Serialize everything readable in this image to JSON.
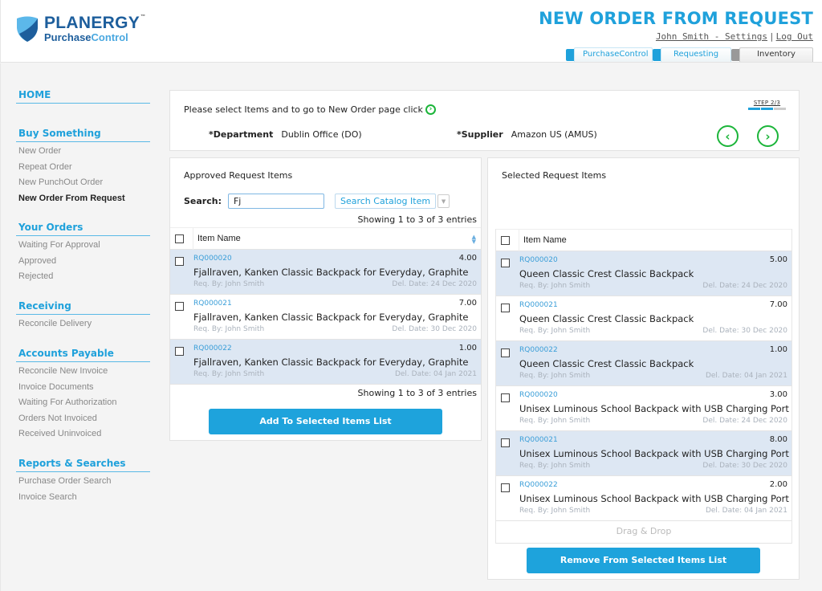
{
  "header": {
    "logo_main": "PLANERGY",
    "logo_tm": "™",
    "logo_sub_a": "Purchase",
    "logo_sub_b": "Control",
    "page_title": "NEW ORDER FROM REQUEST",
    "user_link": "John Smith - Settings",
    "separator": "|",
    "logout_link": "Log Out",
    "app_tabs": [
      {
        "label": "PurchaseControl",
        "color": "#1fa1db"
      },
      {
        "label": "Requesting",
        "color": "#1fa1db"
      },
      {
        "label": "Inventory",
        "color": "#999999"
      }
    ]
  },
  "sidebar": {
    "home": "HOME",
    "groups": [
      {
        "title": "Buy Something",
        "items": [
          "New Order",
          "Repeat Order",
          "New PunchOut Order",
          "New Order From Request"
        ],
        "active": "New Order From Request"
      },
      {
        "title": "Your Orders",
        "items": [
          "Waiting For Approval",
          "Approved",
          "Rejected"
        ]
      },
      {
        "title": "Receiving",
        "items": [
          "Reconcile Delivery"
        ]
      },
      {
        "title": "Accounts Payable",
        "items": [
          "Reconcile New Invoice",
          "Invoice Documents",
          "Waiting For Authorization",
          "Orders Not Invoiced",
          "Received Uninvoiced"
        ]
      },
      {
        "title": "Reports & Searches",
        "items": [
          "Purchase Order Search",
          "Invoice Search"
        ]
      }
    ]
  },
  "order_info": {
    "instruction": "Please select Items and to go to New Order page click",
    "department_label": "*Department",
    "department_value": "Dublin Office (DO)",
    "supplier_label": "*Supplier",
    "supplier_value": "Amazon US (AMUS)",
    "step_label": "STEP 2/3",
    "step_current": 2,
    "step_total": 3
  },
  "approved": {
    "title": "Approved Request Items",
    "search_label": "Search:",
    "search_value": "Fj",
    "catalog_button": "Search Catalog Item",
    "showing_top": "Showing 1 to 3 of 3 entries",
    "showing_bottom": "Showing 1 to 3 of 3 entries",
    "column_header": "Item Name",
    "rows": [
      {
        "rq": "RQ000020",
        "qty": "4.00",
        "name": "Fjallraven, Kanken Classic Backpack for Everyday, Graphite",
        "req_by": "Req. By: John Smith",
        "del_date": "Del. Date: 24 Dec 2020"
      },
      {
        "rq": "RQ000021",
        "qty": "7.00",
        "name": "Fjallraven, Kanken Classic Backpack for Everyday, Graphite",
        "req_by": "Req. By: John Smith",
        "del_date": "Del. Date: 30 Dec 2020"
      },
      {
        "rq": "RQ000022",
        "qty": "1.00",
        "name": "Fjallraven, Kanken Classic Backpack for Everyday, Graphite",
        "req_by": "Req. By: John Smith",
        "del_date": "Del. Date: 04 Jan 2021"
      }
    ],
    "add_button": "Add To Selected Items List"
  },
  "selected": {
    "title": "Selected Request Items",
    "column_header": "Item Name",
    "rows": [
      {
        "rq": "RQ000020",
        "qty": "5.00",
        "name": "Queen Classic Crest Classic Backpack",
        "req_by": "Req. By: John Smith",
        "del_date": "Del. Date: 24 Dec 2020"
      },
      {
        "rq": "RQ000021",
        "qty": "7.00",
        "name": "Queen Classic Crest Classic Backpack",
        "req_by": "Req. By: John Smith",
        "del_date": "Del. Date: 30 Dec 2020"
      },
      {
        "rq": "RQ000022",
        "qty": "1.00",
        "name": "Queen Classic Crest Classic Backpack",
        "req_by": "Req. By: John Smith",
        "del_date": "Del. Date: 04 Jan 2021"
      },
      {
        "rq": "RQ000020",
        "qty": "3.00",
        "name": "Unisex Luminous School Backpack with USB Charging Port",
        "req_by": "Req. By: John Smith",
        "del_date": "Del. Date: 24 Dec 2020"
      },
      {
        "rq": "RQ000021",
        "qty": "8.00",
        "name": "Unisex Luminous School Backpack with USB Charging Port",
        "req_by": "Req. By: John Smith",
        "del_date": "Del. Date: 30 Dec 2020"
      },
      {
        "rq": "RQ000022",
        "qty": "2.00",
        "name": "Unisex Luminous School Backpack with USB Charging Port",
        "req_by": "Req. By: John Smith",
        "del_date": "Del. Date: 04 Jan 2021"
      }
    ],
    "drag_drop": "Drag & Drop",
    "remove_button": "Remove From Selected Items List"
  },
  "colors": {
    "accent": "#1fa1db",
    "brand_dark": "#1d5e9c",
    "nav_green": "#1cb53a",
    "row_highlight": "#dde7f3"
  }
}
